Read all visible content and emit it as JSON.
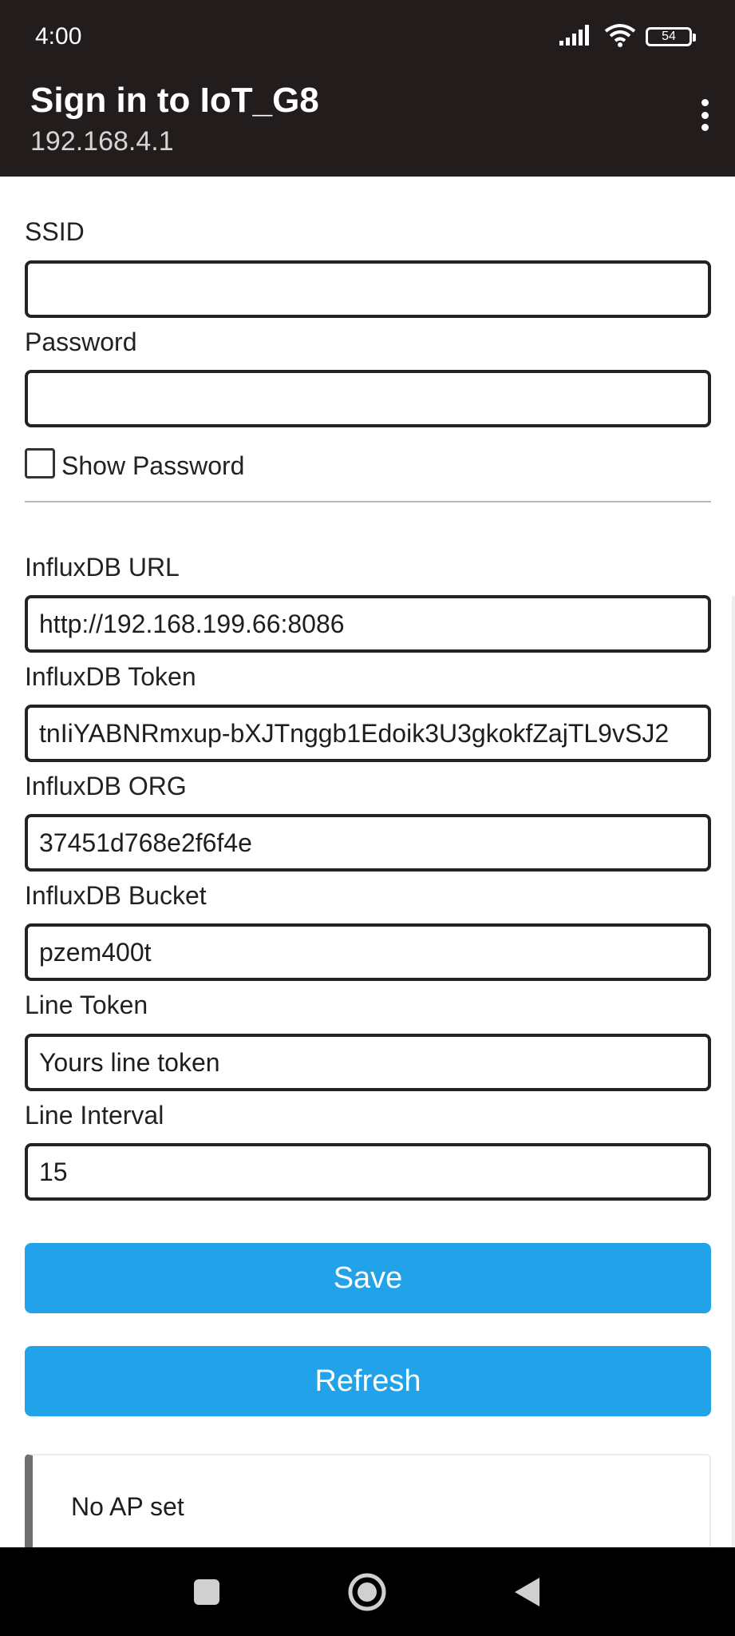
{
  "status_bar": {
    "time": "4:00",
    "battery_level": "54",
    "icons": [
      "signal-icon",
      "wifi-icon",
      "battery-icon"
    ]
  },
  "app_bar": {
    "title": "Sign in to IoT_G8",
    "subtitle": "192.168.4.1",
    "menu_icon": "more-vert-icon"
  },
  "form": {
    "ssid": {
      "label": "SSID",
      "value": ""
    },
    "password": {
      "label": "Password",
      "value": ""
    },
    "show_password": {
      "label": "Show Password",
      "checked": false
    },
    "influx_url": {
      "label": "InfluxDB URL",
      "value": "http://192.168.199.66:8086"
    },
    "influx_token": {
      "label": "InfluxDB Token",
      "value": "tnIiYABNRmxup-bXJTnggb1Edoik3U3gkokfZajTL9vSJ2"
    },
    "influx_org": {
      "label": "InfluxDB ORG",
      "value": "37451d768e2f6f4e"
    },
    "influx_bucket": {
      "label": "InfluxDB Bucket",
      "value": "pzem400t"
    },
    "line_token": {
      "label": "Line Token",
      "value": "Yours line token"
    },
    "line_interval": {
      "label": "Line Interval",
      "value": "15"
    }
  },
  "buttons": {
    "save": "Save",
    "refresh": "Refresh"
  },
  "status_message": "No AP set",
  "colors": {
    "header_bg": "#221c1d",
    "button_blue": "#22a3e9",
    "field_border": "#222222",
    "navbar_bg": "#000000"
  },
  "nav_bar": {
    "icons": [
      "recents-square-icon",
      "home-circle-icon",
      "back-triangle-icon"
    ]
  }
}
